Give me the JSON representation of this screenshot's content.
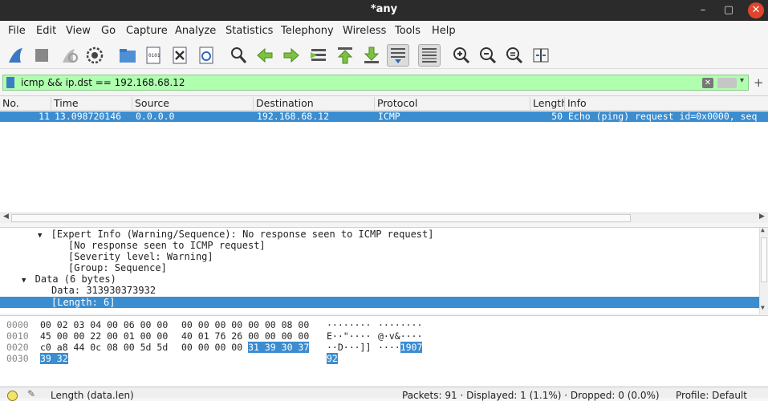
{
  "window": {
    "title": "*any"
  },
  "menu": [
    "File",
    "Edit",
    "View",
    "Go",
    "Capture",
    "Analyze",
    "Statistics",
    "Telephony",
    "Wireless",
    "Tools",
    "Help"
  ],
  "filter": {
    "value": "icmp && ip.dst == 192.168.68.12"
  },
  "columns": [
    "No.",
    "Time",
    "Source",
    "Destination",
    "Protocol",
    "Length",
    "Info"
  ],
  "packets": [
    {
      "no": "11",
      "time": "13.098720146",
      "source": "0.0.0.0",
      "destination": "192.168.68.12",
      "protocol": "ICMP",
      "length": "50",
      "info": "Echo (ping) request  id=0x0000, seq"
    }
  ],
  "details": [
    "[Expert Info (Warning/Sequence): No response seen to ICMP request]",
    "[No response seen to ICMP request]",
    "[Severity level: Warning]",
    "[Group: Sequence]",
    "Data (6 bytes)",
    "Data: 313930373932",
    "[Length: 6]"
  ],
  "hex": [
    {
      "offset": "0000",
      "bytes_a": "00 02 03 04 00 06 00 00",
      "bytes_b": "00 00 00 00 00 00 08 00",
      "hl_b": "",
      "ascii_a": "········",
      "ascii_b": "········",
      "hl_ascii": ""
    },
    {
      "offset": "0010",
      "bytes_a": "45 00 00 22 00 01 00 00",
      "bytes_b": "40 01 76 26 00 00 00 00",
      "hl_b": "",
      "ascii_a": "E··\"····",
      "ascii_b": "@·v&····",
      "hl_ascii": ""
    },
    {
      "offset": "0020",
      "bytes_a": "c0 a8 44 0c 08 00 5d 5d",
      "bytes_b": "00 00 00 00",
      "hl_b": "31 39 30 37",
      "ascii_a": "··D···]]",
      "ascii_b": "····",
      "hl_ascii": "1907"
    },
    {
      "offset": "0030",
      "bytes_a": "",
      "bytes_b": "",
      "hl_b": "39 32",
      "ascii_a": "",
      "ascii_b": "",
      "hl_ascii": "92"
    }
  ],
  "status": {
    "field": "Length (data.len)",
    "packets": "Packets: 91 · Displayed: 1 (1.1%) · Dropped: 0 (0.0%)",
    "profile": "Profile: Default"
  }
}
